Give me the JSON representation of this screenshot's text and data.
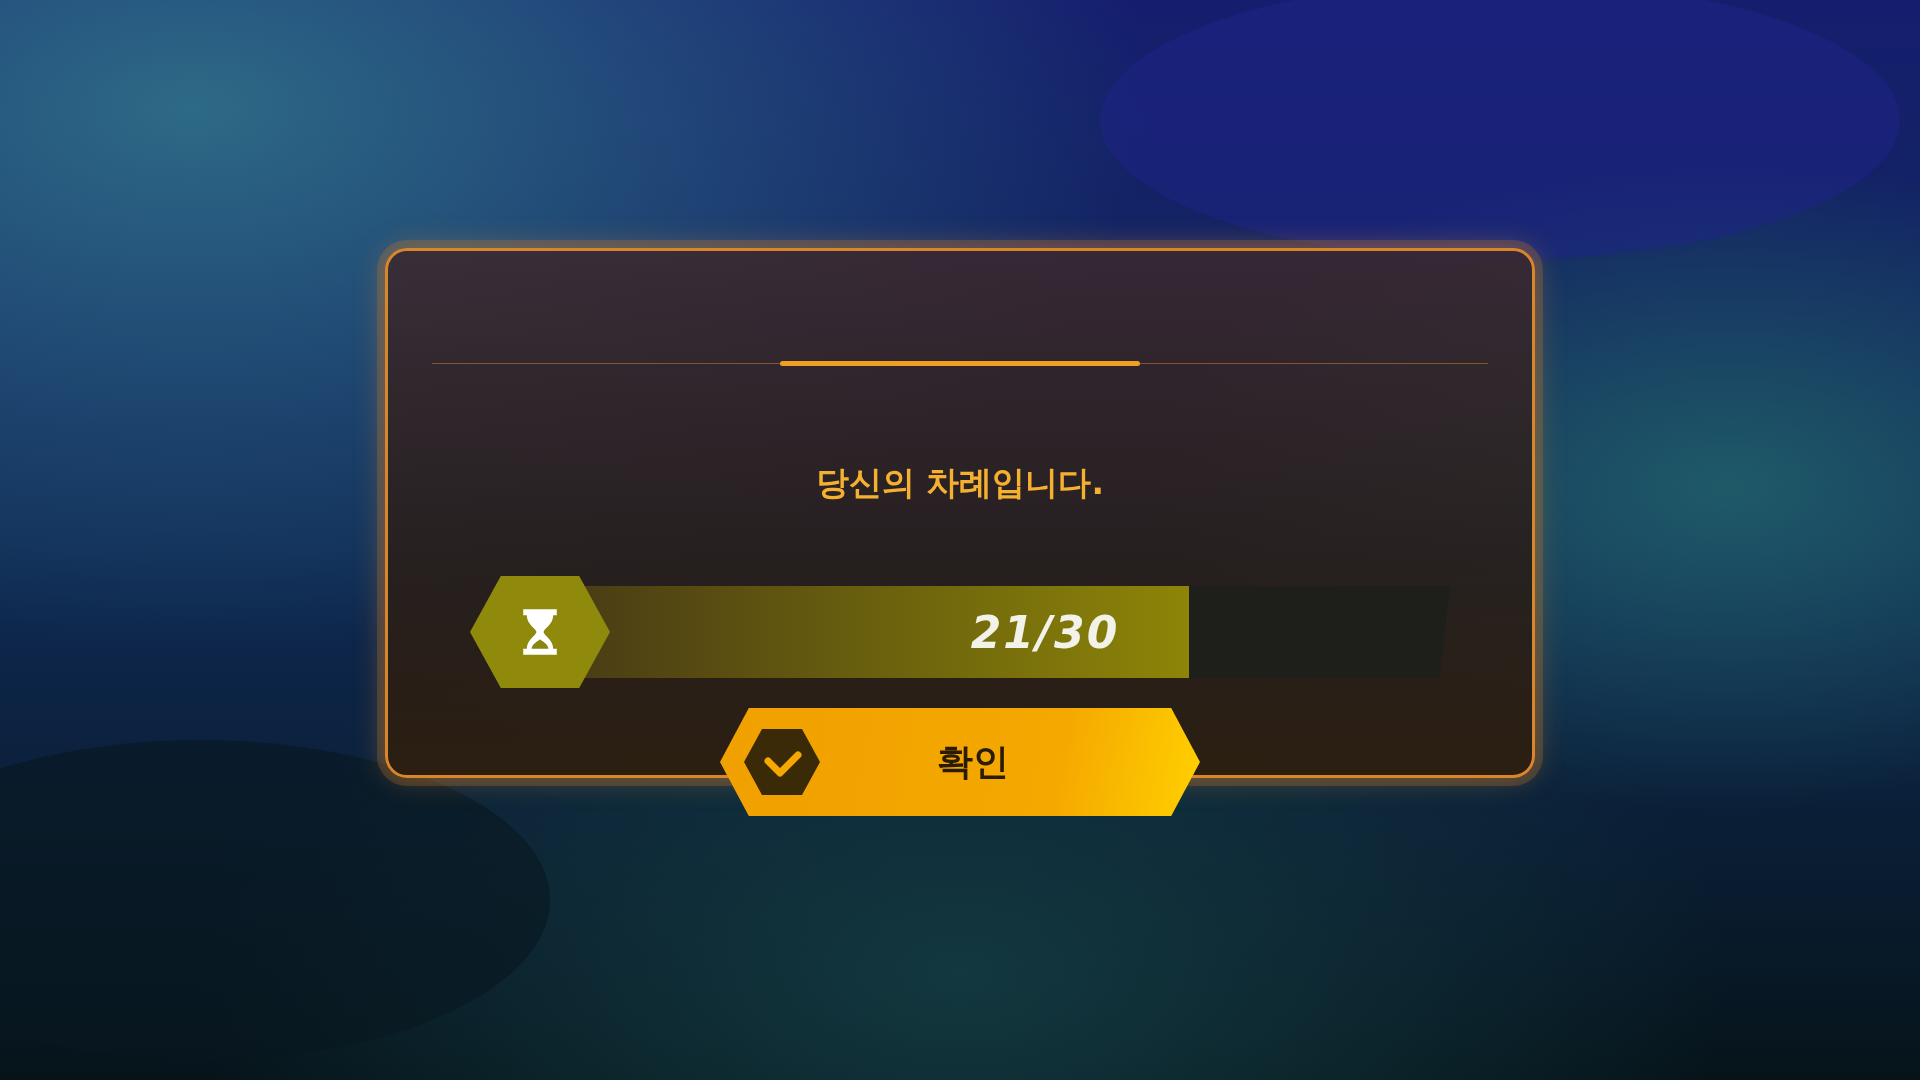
{
  "dialog": {
    "message": "당신의 차례입니다.",
    "timer": {
      "level": 0.7,
      "reading": "21/30"
    },
    "confirm_button": {
      "label": "확인"
    }
  }
}
